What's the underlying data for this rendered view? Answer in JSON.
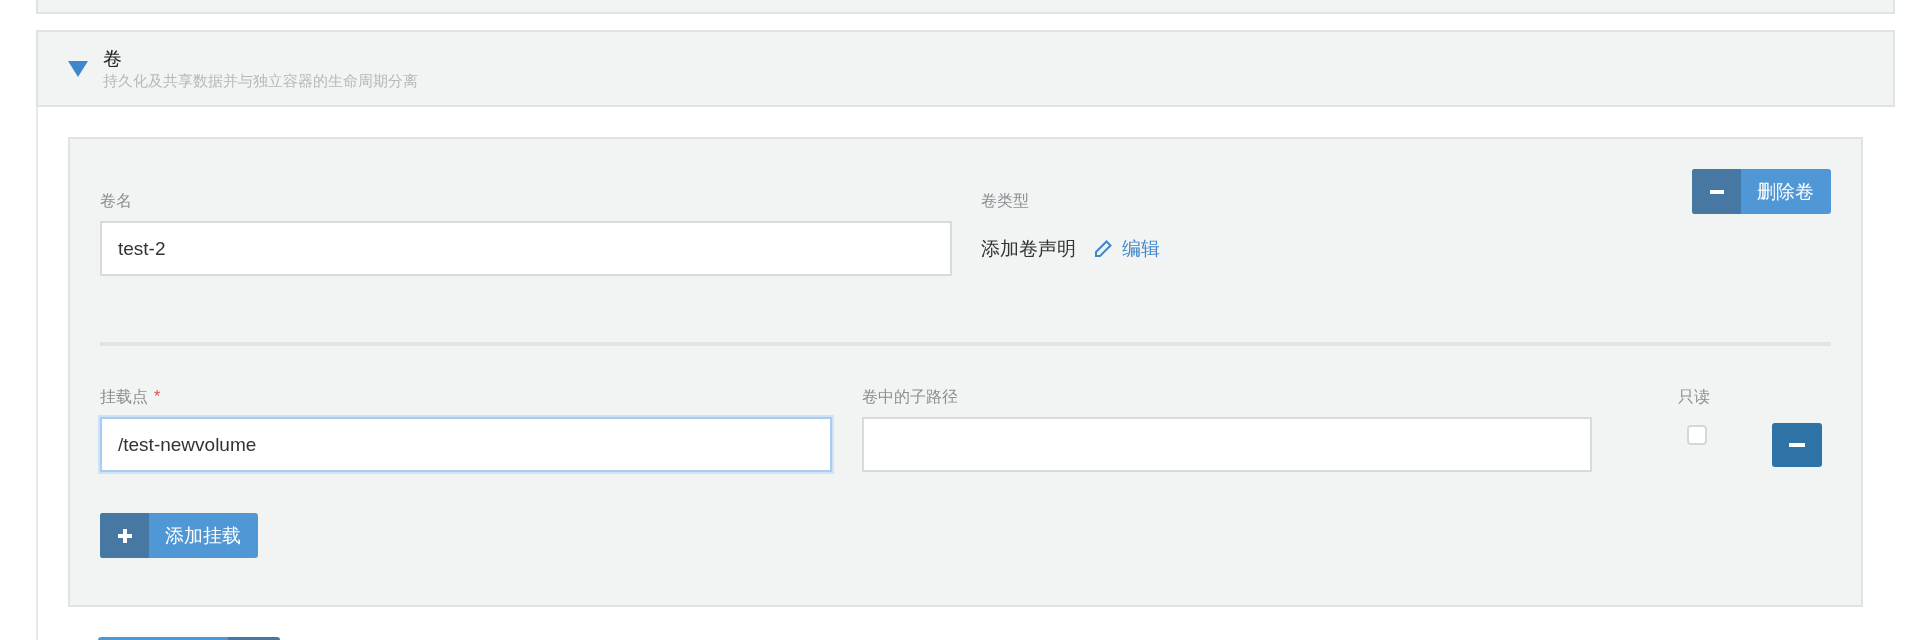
{
  "section": {
    "title": "卷",
    "subtitle": "持久化及共享数据并与独立容器的生命周期分离",
    "expanded": true
  },
  "volume": {
    "name_label": "卷名",
    "name_value": "test-2",
    "type_label": "卷类型",
    "type_value": "添加卷声明",
    "edit_link": "编辑",
    "delete_button": "删除卷"
  },
  "mounts": [
    {
      "mount_label": "挂载点",
      "required_mark": "*",
      "mount_value": "/test-newvolume",
      "focused": true,
      "subpath_label": "卷中的子路径",
      "readonly_label": "只读",
      "readonly": false
    }
  ],
  "add_mount_button": "添加挂载"
}
